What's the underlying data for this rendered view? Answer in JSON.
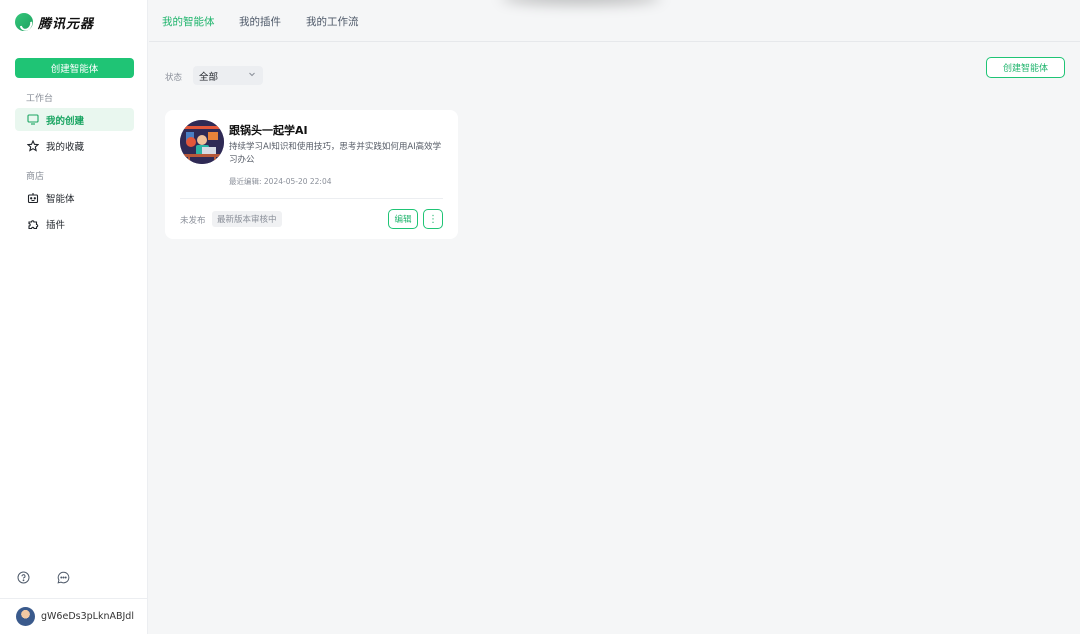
{
  "app": {
    "logo_text": "腾讯元器"
  },
  "sidebar": {
    "create_label": "创建智能体",
    "group_workspace": "工作台",
    "items_workspace": [
      {
        "label": "我的创建",
        "icon": "monitor-icon",
        "active": true
      },
      {
        "label": "我的收藏",
        "icon": "star-icon"
      }
    ],
    "group_store": "商店",
    "items_store": [
      {
        "label": "智能体",
        "icon": "robot-icon"
      },
      {
        "label": "插件",
        "icon": "puzzle-icon"
      }
    ],
    "footer_icons": [
      "help-circle-icon",
      "chat-bubble-icon"
    ],
    "username": "gW6eDs3pLknABJdl"
  },
  "tabs": [
    {
      "label": "我的智能体",
      "active": true
    },
    {
      "label": "我的插件"
    },
    {
      "label": "我的工作流"
    }
  ],
  "main": {
    "create_label": "创建智能体",
    "status_label": "状态",
    "status_value": "全部"
  },
  "card": {
    "title": "跟锅头一起学AI",
    "description": "持续学习AI知识和使用技巧，思考并实践如何用AI高效学习办公",
    "time": "最近编辑: 2024-05-20 22:04",
    "status": "未发布",
    "badge": "最新版本审核中",
    "edit_label": "编辑",
    "more_label": "⋮"
  },
  "colors": {
    "accent": "#1fc475",
    "accent_text": "#1fb46c"
  }
}
